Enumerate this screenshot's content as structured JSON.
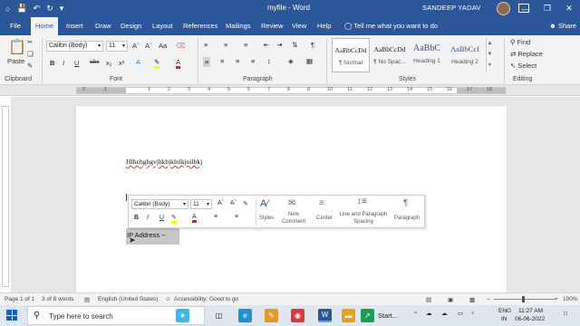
{
  "titlebar": {
    "title": "myfile - Word",
    "user": "SANDEEP YADAV",
    "autosave_icon": "save-icon",
    "undo_icon": "undo-icon",
    "redo_icon": "redo-icon",
    "customize_icon": "customize-quick-access-icon"
  },
  "tabs": [
    "File",
    "Home",
    "Insert",
    "Draw",
    "Design",
    "Layout",
    "References",
    "Mailings",
    "Review",
    "View",
    "Help"
  ],
  "active_tab": "Home",
  "tell_me": "Tell me what you want to do",
  "share": "Share",
  "ribbon": {
    "clipboard": {
      "paste": "Paste",
      "label": "Clipboard"
    },
    "font": {
      "name": "Calibri (Body)",
      "size": "11",
      "label": "Font",
      "grow": "Aˆ",
      "shrink": "Aˇ",
      "case": "Aa",
      "bold": "B",
      "italic": "I",
      "underline": "U",
      "strike": "abc",
      "sub": "x₂",
      "sup": "x²",
      "color_label": "A"
    },
    "paragraph": {
      "label": "Paragraph",
      "pilcrow": "¶"
    },
    "styles": {
      "label": "Styles",
      "items": [
        {
          "sample": "AaBbCcDd",
          "name": "¶ Normal"
        },
        {
          "sample": "AaBbCcDd",
          "name": "¶ No Spac..."
        },
        {
          "sample": "AaBbC",
          "name": "Heading 1"
        },
        {
          "sample": "AaBbCcI",
          "name": "Heading 2"
        }
      ]
    },
    "editing": {
      "label": "Editing",
      "find": "Find",
      "replace": "Replace",
      "select": "Select"
    }
  },
  "ruler_numbers": [
    "2",
    "1",
    "1",
    "2",
    "3",
    "4",
    "5",
    "6",
    "7",
    "8",
    "9",
    "10",
    "11",
    "12",
    "13",
    "14",
    "15",
    "16",
    "17",
    "18"
  ],
  "document": {
    "line1": "Hfhchghgvjhkbjklnlkjoilbkj",
    "selected_text": "IP Address   --"
  },
  "mini_toolbar": {
    "font": "Calibri (Body)",
    "size": "11",
    "grow": "Aˆ",
    "shrink": "Aˇ",
    "bold": "B",
    "italic": "I",
    "underline": "U",
    "color": "A",
    "styles_label": "Styles",
    "new_comment": "New Comment",
    "center": "Center",
    "line_spacing": "Line and Paragraph Spacing",
    "paragraph": "Paragraph"
  },
  "status": {
    "page": "Page 1 of 1",
    "words": "3 of 8 words",
    "language": "English (United States)",
    "accessibility": "Accessibility: Good to go",
    "zoom": "100%"
  },
  "taskbar": {
    "search_placeholder": "Type here to search",
    "start_label": "Start...",
    "lang": "ENG",
    "region": "IN",
    "time": "11:27 AM",
    "date": "06-06-2022"
  },
  "colors": {
    "word_blue": "#2b579a",
    "ribbon_bg": "#f3f3f3",
    "highlight": "#ffff00",
    "font_color": "#e41b1b"
  }
}
